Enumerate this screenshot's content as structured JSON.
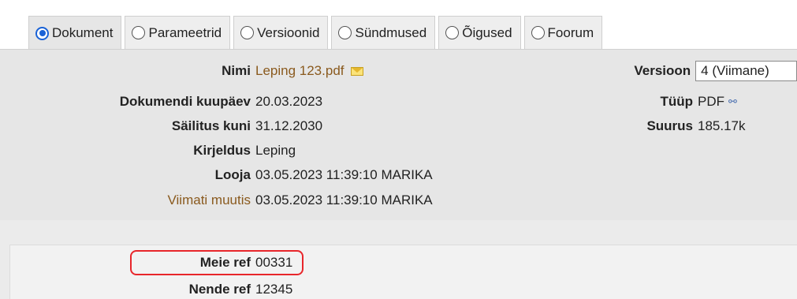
{
  "tabs": [
    {
      "label": "Dokument",
      "active": true
    },
    {
      "label": "Parameetrid",
      "active": false
    },
    {
      "label": "Versioonid",
      "active": false
    },
    {
      "label": "Sündmused",
      "active": false
    },
    {
      "label": "Õigused",
      "active": false
    },
    {
      "label": "Foorum",
      "active": false
    }
  ],
  "fields_left": {
    "nimi_label": "Nimi",
    "nimi_value": "Leping 123.pdf",
    "kuupaev_label": "Dokumendi kuupäev",
    "kuupaev_value": "20.03.2023",
    "sailitus_label": "Säilitus kuni",
    "sailitus_value": "31.12.2030",
    "kirjeldus_label": "Kirjeldus",
    "kirjeldus_value": "Leping",
    "looja_label": "Looja",
    "looja_value": "03.05.2023 11:39:10 MARIKA",
    "viimati_label": "Viimati muutis",
    "viimati_value": "03.05.2023 11:39:10 MARIKA"
  },
  "fields_right": {
    "versioon_label": "Versioon",
    "versioon_value": "4 (Viimane)",
    "tuup_label": "Tüüp",
    "tuup_value": "PDF",
    "suurus_label": "Suurus",
    "suurus_value": "185.17k"
  },
  "lower": {
    "meie_ref_label": "Meie ref",
    "meie_ref_value": "00331",
    "nende_ref_label": "Nende ref",
    "nende_ref_value": "12345"
  },
  "icons": {
    "mail": "envelope-icon",
    "file_link": "link-icon",
    "radio": "radio-icon"
  },
  "colors": {
    "panel_bg": "#e6e6e6",
    "link_brown": "#8a5a1e",
    "radio_blue": "#1a62d6",
    "highlight_red": "#e8262b"
  }
}
